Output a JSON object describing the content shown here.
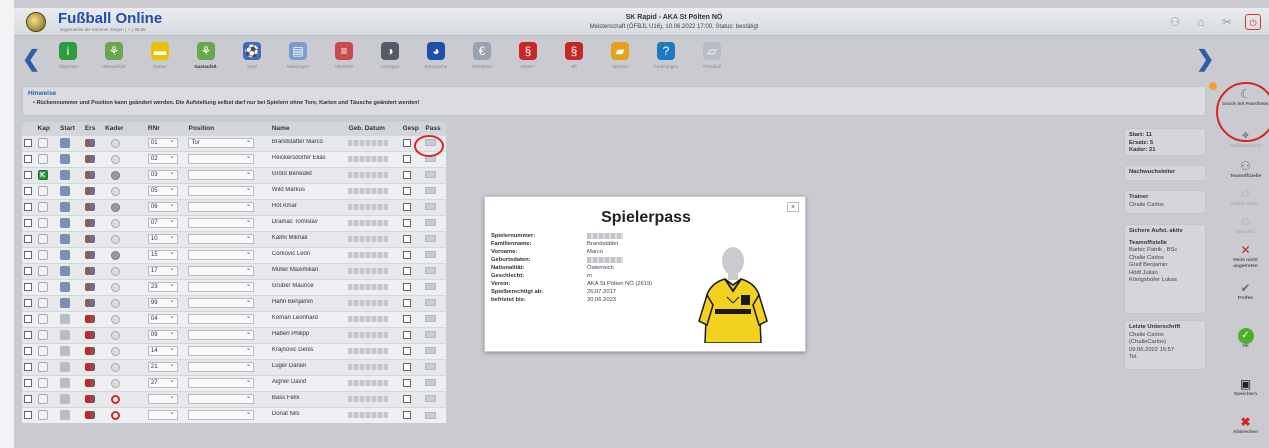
{
  "header": {
    "title": "Fußball Online",
    "login": "angemeldet als Sommer Jürgen ( + ) 88:55",
    "match": "SK Rapid - AKA St Pölten NÖ",
    "match_details": "Meisterschaft (ÖFBJL U16), 10.06.2022 17:00, Status: bestätigt"
  },
  "toolbar": {
    "items": [
      {
        "label": "Allgemein",
        "icon": "info-icon",
        "color": "#2e9c3e"
      },
      {
        "label": "Heimaufstel.",
        "icon": "lineup-home-icon",
        "color": "#6aa84f"
      },
      {
        "label": "Ordner",
        "icon": "folder-icon",
        "color": "#e8c200"
      },
      {
        "label": "Gastaufstl.",
        "icon": "lineup-guest-icon",
        "color": "#6aa84f"
      },
      {
        "label": "Spiel",
        "icon": "match-icon",
        "color": "#3b6cc2"
      },
      {
        "label": "Meldungen",
        "icon": "report-icon",
        "color": "#7a9ccf"
      },
      {
        "label": "Übersicht",
        "icon": "overview-icon",
        "color": "#c94a4a"
      },
      {
        "label": "Anzeigen",
        "icon": "display-icon",
        "color": "#555a66"
      },
      {
        "label": "Einsprüche",
        "icon": "objection-icon",
        "color": "#1f4fa8"
      },
      {
        "label": "Gebühren",
        "icon": "euro-icon",
        "color": "#9aa3b3"
      },
      {
        "label": "Strafe I",
        "icon": "penalty-icon",
        "color": "#c62828"
      },
      {
        "label": "Bfi",
        "icon": "bfi-icon",
        "color": "#c62828"
      },
      {
        "label": "Sperren",
        "icon": "ban-icon",
        "color": "#e3a21a"
      },
      {
        "label": "Änderungen",
        "icon": "help-icon",
        "color": "#1f79c2"
      },
      {
        "label": "Protokoll",
        "icon": "protocol-icon",
        "color": "#b9bcc4"
      }
    ]
  },
  "hints": {
    "title": "Hinweise",
    "text": "• Rückennummer und Position kann geändert werden. Die Aufstellung selbst darf nur bei Spielern ohne Tore, Karten und Täusche geändert werden!"
  },
  "table": {
    "columns": [
      "Kap",
      "Start",
      "Ers",
      "Kader",
      "RNr",
      "Position",
      "Name",
      "Geb. Datum",
      "Gesp",
      "Pass"
    ],
    "rows": [
      {
        "kap": "",
        "start": true,
        "kader": "light",
        "nr": "01",
        "pos": "Tor",
        "name": "Brandstätter Marco"
      },
      {
        "kap": "",
        "start": true,
        "kader": "light",
        "nr": "02",
        "pos": "",
        "name": "Reickersdorfer Elias"
      },
      {
        "kap": "K",
        "start": true,
        "kader": "grey",
        "nr": "03",
        "pos": "",
        "name": "Größl Benedikt"
      },
      {
        "kap": "",
        "start": true,
        "kader": "light",
        "nr": "05",
        "pos": "",
        "name": "Wild Markus"
      },
      {
        "kap": "",
        "start": true,
        "kader": "grey",
        "nr": "06",
        "pos": "",
        "name": "Hot Amar"
      },
      {
        "kap": "",
        "start": true,
        "kader": "light",
        "nr": "07",
        "pos": "",
        "name": "Dramac Tomislav"
      },
      {
        "kap": "",
        "start": true,
        "kader": "light",
        "nr": "10",
        "pos": "",
        "name": "Kalmi Mikhail"
      },
      {
        "kap": "",
        "start": true,
        "kader": "grey",
        "nr": "15",
        "pos": "",
        "name": "Corkovic Leon"
      },
      {
        "kap": "",
        "start": true,
        "kader": "light",
        "nr": "17",
        "pos": "",
        "name": "Müller Maximilian"
      },
      {
        "kap": "",
        "start": true,
        "kader": "light",
        "nr": "23",
        "pos": "",
        "name": "Gruber Maurice"
      },
      {
        "kap": "",
        "start": true,
        "kader": "light",
        "nr": "99",
        "pos": "",
        "name": "Hahn Benjamin"
      },
      {
        "kap": "",
        "start": false,
        "kader": "light",
        "nr": "04",
        "pos": "",
        "name": "Koman Leonhard"
      },
      {
        "kap": "",
        "start": false,
        "kader": "light",
        "nr": "09",
        "pos": "",
        "name": "Haberl Philipp"
      },
      {
        "kap": "",
        "start": false,
        "kader": "light",
        "nr": "14",
        "pos": "",
        "name": "Krajnovic Denis"
      },
      {
        "kap": "",
        "start": false,
        "kader": "light",
        "nr": "21",
        "pos": "",
        "name": "Luger Daniel"
      },
      {
        "kap": "",
        "start": false,
        "kader": "light",
        "nr": "27",
        "pos": "",
        "name": "Aigner David"
      },
      {
        "kap": "",
        "start": false,
        "kader": "red",
        "nr": "",
        "pos": "",
        "name": "Bass Felix"
      },
      {
        "kap": "",
        "start": false,
        "kader": "red",
        "nr": "",
        "pos": "",
        "name": "Donat Nils"
      }
    ]
  },
  "popup": {
    "title": "Spielerpass",
    "close": "×",
    "fields": [
      {
        "k": "Spielernummer:",
        "v": ""
      },
      {
        "k": "Familienname:",
        "v": "Brandstätter"
      },
      {
        "k": "Vorname:",
        "v": "Marco"
      },
      {
        "k": "Geburtsdaten:",
        "v": ""
      },
      {
        "k": "Nationalität:",
        "v": "Österreich"
      },
      {
        "k": "Geschlecht:",
        "v": "m"
      },
      {
        "k": "Verein:",
        "v": "AKA St Pölten NÖ (2619)"
      },
      {
        "k": "Spielberechtigt ab:",
        "v": "26.07.2017"
      },
      {
        "k": "befristet bis:",
        "v": "30.06.2023"
      }
    ]
  },
  "info": {
    "start": "Start: 11",
    "ersatz": "Ersatz: 5",
    "kader": "Kader: 21",
    "nachwuchs": "Nachwuchsleiter",
    "trainer_label": "Trainer",
    "trainer": "Chalie Carlos",
    "sichere": "Sichere Aufst. aktiv",
    "team_label": "Teamoffizielle",
    "team": [
      "Barbic Patrik , BSc",
      "Chalie Carlos",
      "Greif Benjamin",
      "Hödl Julian",
      "Königshofer Lukas"
    ],
    "letzte_label": "Letzte Unterschrift",
    "letzte": [
      "Chalie Carlos",
      "(ChalieCarlos)",
      "09.06.2022 15:57",
      "Tel. "
    ]
  },
  "actions": {
    "print": "Druck mit Passfotos",
    "rollen": "Rollentausch",
    "teamoff": "Teamoffizielle",
    "letzte": "Letzte Aufst.",
    "vorauf": "Voraufst.",
    "heim": "Heim nicht angetreten",
    "pruefen": "Prüfen",
    "ok": "Ok",
    "speichern": "Speichern",
    "abbrechen": "Abbrechen"
  }
}
